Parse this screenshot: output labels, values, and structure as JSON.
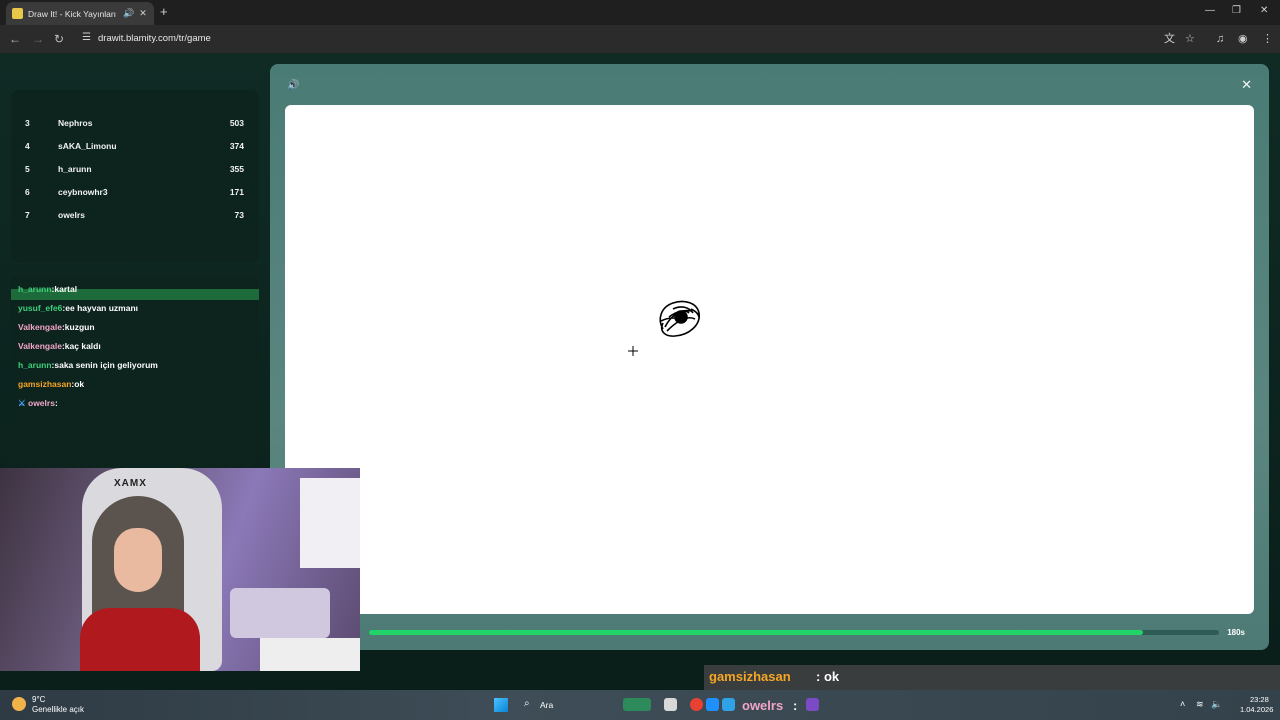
{
  "browser": {
    "tab_title": "Draw It! - Kick Yayınları İçin",
    "url": "drawit.blamity.com/tr/game"
  },
  "leaderboard": {
    "rows": [
      {
        "rank": "3",
        "name": "Nephros",
        "score": "503"
      },
      {
        "rank": "4",
        "name": "sAKA_Limonu",
        "score": "374"
      },
      {
        "rank": "5",
        "name": "h_arunn",
        "score": "355"
      },
      {
        "rank": "6",
        "name": "ceybnowhr3",
        "score": "171"
      },
      {
        "rank": "7",
        "name": "owelrs",
        "score": "73"
      }
    ]
  },
  "chat": {
    "messages": [
      {
        "user": "h_arunn",
        "text": "kartal",
        "color": "#3fd17a"
      },
      {
        "user": "yusuf_efe6",
        "text": "ee hayvan uzmanı",
        "color": "#3fd17a"
      },
      {
        "user": "Valkengale",
        "text": "kuzgun",
        "color": "#f3a6c8"
      },
      {
        "user": "Valkengale",
        "text": "kaç kaldı",
        "color": "#f3a6c8"
      },
      {
        "user": "h_arunn",
        "text": "saka senin için geliyorum",
        "color": "#3fd17a"
      },
      {
        "user": "gamsizhasan",
        "text": "ok",
        "color": "#f5a623"
      },
      {
        "user": "owelrs",
        "text": "",
        "color": "#f3a6c8"
      }
    ]
  },
  "game": {
    "timer": "180s",
    "progress": 0.91
  },
  "webcam": {
    "chair_brand": "XAMX"
  },
  "overlay": {
    "user": "gamsizhasan",
    "text": ": ok"
  },
  "taskbar": {
    "temperature": "9°C",
    "weather": "Genellikle açık",
    "search": "Ara",
    "overlay_user": "owelrs",
    "overlay_sep": ":",
    "time": "23:28",
    "date": "1.04.2026"
  }
}
